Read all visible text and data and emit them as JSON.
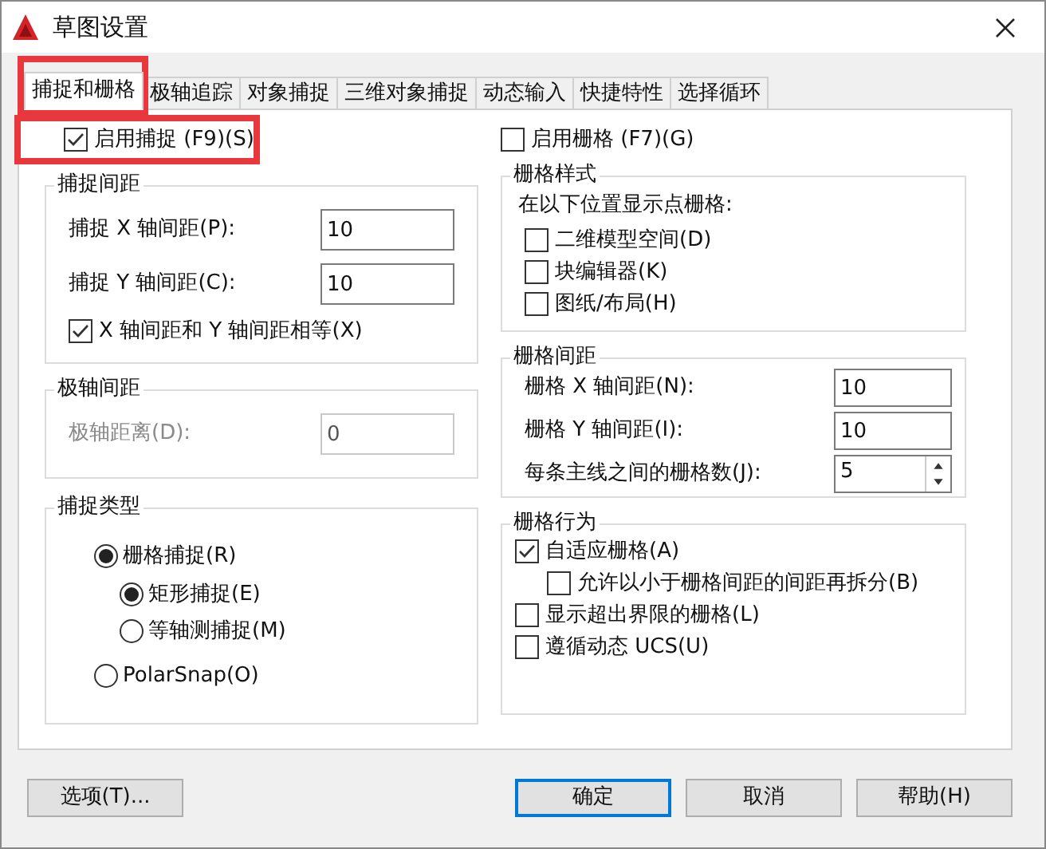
{
  "window": {
    "title": "草图设置"
  },
  "tabs": [
    {
      "label": "捕捉和栅格",
      "selected": true
    },
    {
      "label": "极轴追踪",
      "selected": false
    },
    {
      "label": "对象捕捉",
      "selected": false
    },
    {
      "label": "三维对象捕捉",
      "selected": false
    },
    {
      "label": "动态输入",
      "selected": false
    },
    {
      "label": "快捷特性",
      "selected": false
    },
    {
      "label": "选择循环",
      "selected": false
    }
  ],
  "snap_enabled": {
    "label": "启用捕捉 (F9)(S)",
    "checked": true
  },
  "grid_enabled": {
    "label": "启用栅格 (F7)(G)",
    "checked": false
  },
  "snap_spacing": {
    "title": "捕捉间距",
    "fields": [
      {
        "label": "捕捉 X 轴间距(P):",
        "value": "10"
      },
      {
        "label": "捕捉 Y 轴间距(C):",
        "value": "10"
      }
    ],
    "equal": {
      "label": "X 轴间距和 Y 轴间距相等(X)",
      "checked": true
    }
  },
  "polar_spacing": {
    "title": "极轴间距",
    "field": {
      "label": "极轴距离(D):",
      "value": "0",
      "disabled": true
    }
  },
  "snap_type": {
    "title": "捕捉类型",
    "options": [
      {
        "label": "栅格捕捉(R)",
        "selected": true,
        "children": [
          {
            "label": "矩形捕捉(E)",
            "selected": true
          },
          {
            "label": "等轴测捕捉(M)",
            "selected": false
          }
        ]
      },
      {
        "label": "PolarSnap(O)",
        "selected": false
      }
    ]
  },
  "grid_style": {
    "title": "栅格样式",
    "caption": "在以下位置显示点栅格:",
    "options": [
      {
        "label": "二维模型空间(D)",
        "checked": false
      },
      {
        "label": "块编辑器(K)",
        "checked": false
      },
      {
        "label": "图纸/布局(H)",
        "checked": false
      }
    ]
  },
  "grid_spacing": {
    "title": "栅格间距",
    "fields": [
      {
        "label": "栅格 X 轴间距(N):",
        "value": "10",
        "kind": "text"
      },
      {
        "label": "栅格 Y 轴间距(I):",
        "value": "10",
        "kind": "text"
      },
      {
        "label": "每条主线之间的栅格数(J):",
        "value": "5",
        "kind": "spinner"
      }
    ]
  },
  "grid_behavior": {
    "title": "栅格行为",
    "options": [
      {
        "label": "自适应栅格(A)",
        "checked": true,
        "children": [
          {
            "label": "允许以小于栅格间距的间距再拆分(B)",
            "checked": false
          }
        ]
      },
      {
        "label": "显示超出界限的栅格(L)",
        "checked": false
      },
      {
        "label": "遵循动态 UCS(U)",
        "checked": false
      }
    ]
  },
  "options_button": "选项(T)...",
  "buttons": [
    {
      "label": "确定",
      "kind": "default"
    },
    {
      "label": "取消",
      "kind": "normal"
    },
    {
      "label": "帮助(H)",
      "kind": "normal"
    }
  ]
}
